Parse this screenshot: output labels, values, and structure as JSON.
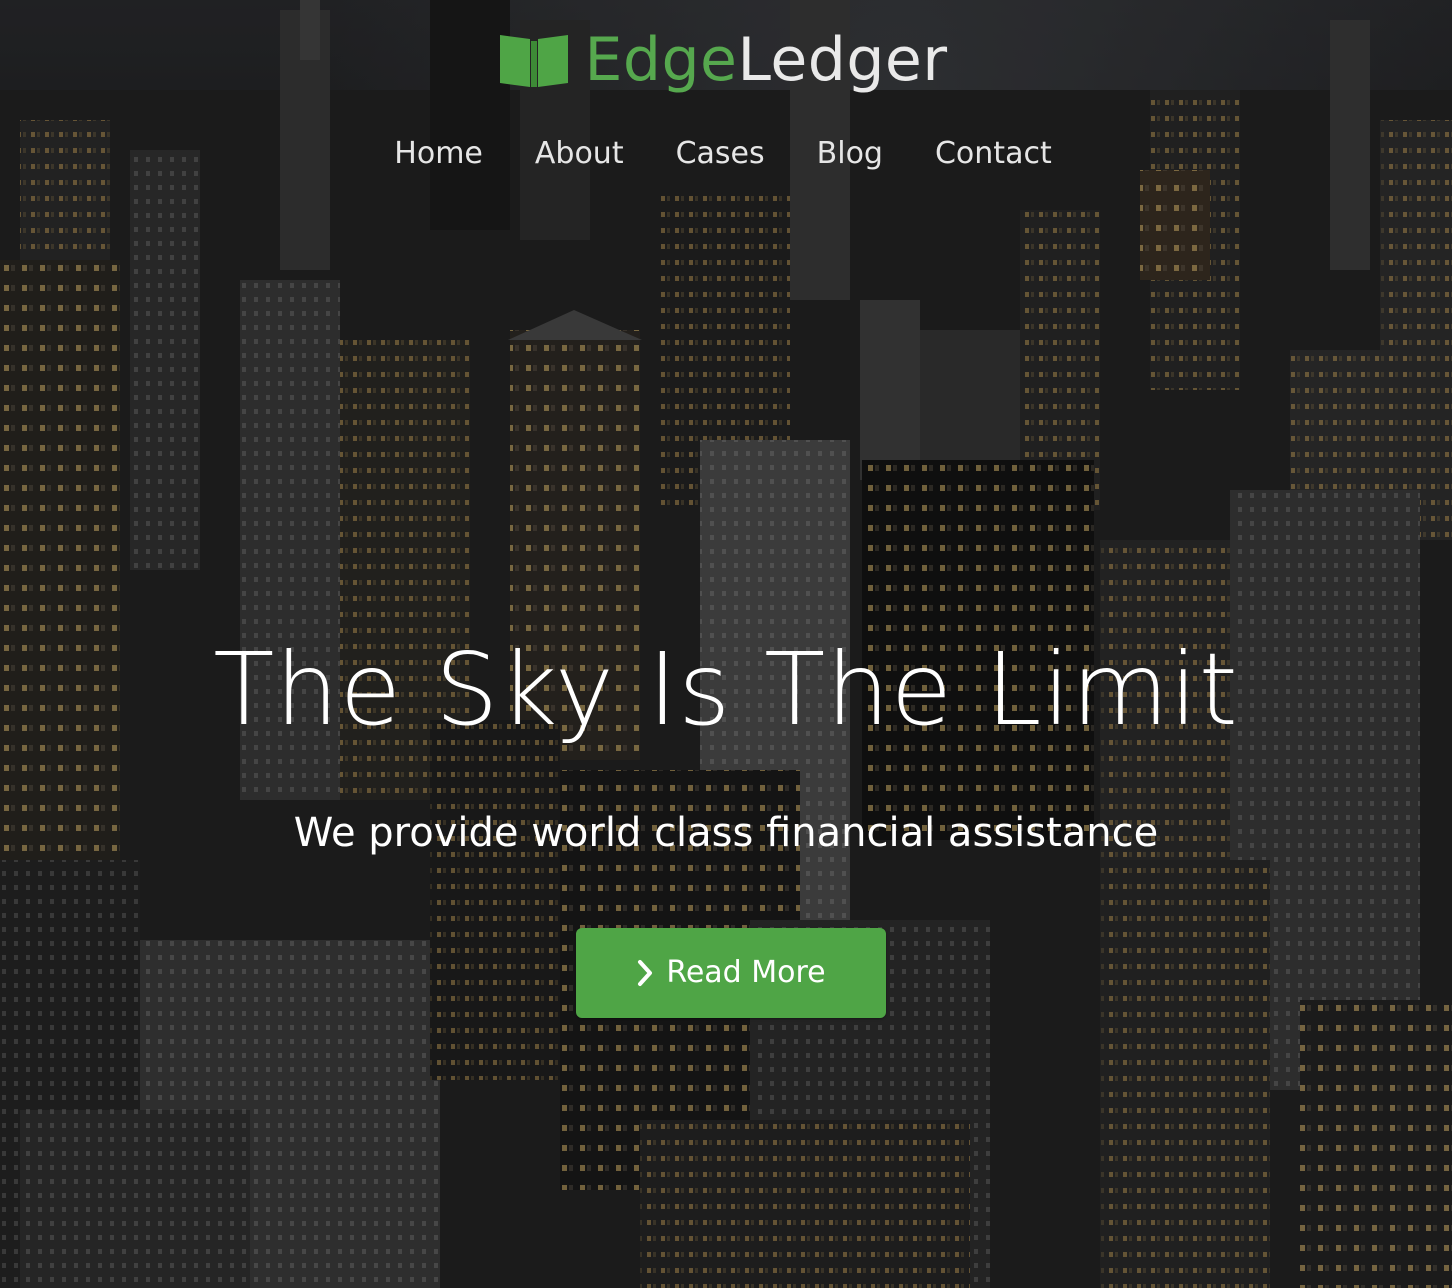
{
  "brand": {
    "name_part1": "Edge",
    "name_part2": "Ledger",
    "logo_icon": "open-book-icon",
    "accent_color": "#4fa546"
  },
  "nav": {
    "items": [
      {
        "label": "Home"
      },
      {
        "label": "About"
      },
      {
        "label": "Cases"
      },
      {
        "label": "Blog"
      },
      {
        "label": "Contact"
      }
    ]
  },
  "hero": {
    "headline": "The Sky Is The Limit",
    "subheadline": "We provide world class financial assistance",
    "cta": {
      "label": "Read More",
      "icon": "chevron-right-icon",
      "color": "#4fa546"
    },
    "background": "night city skyline photo"
  }
}
